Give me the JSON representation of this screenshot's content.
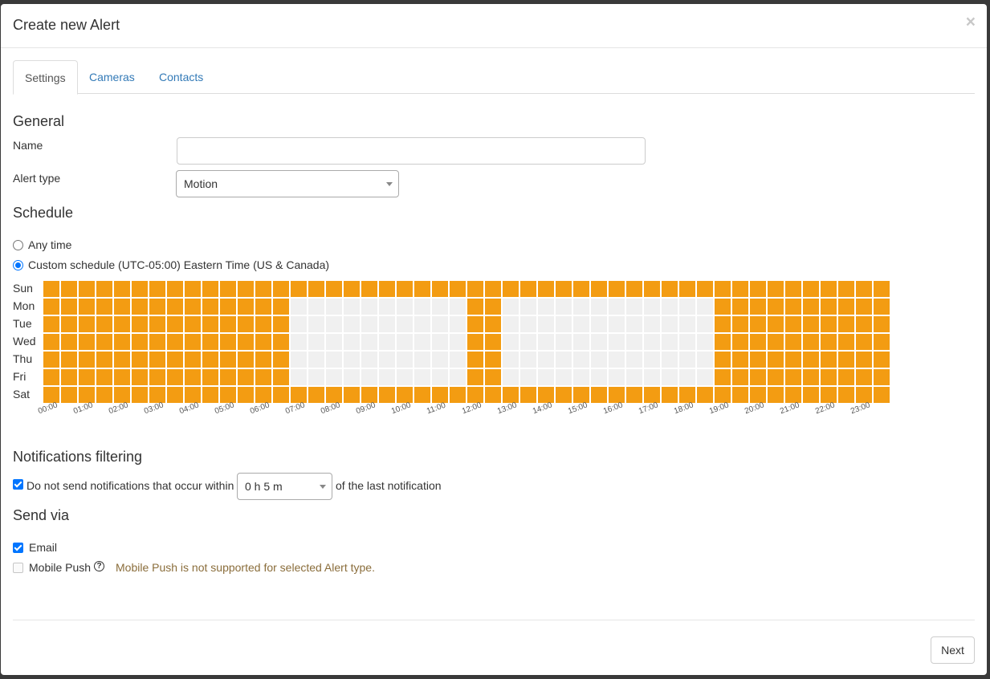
{
  "dialog": {
    "title": "Create new Alert",
    "close_label": "×"
  },
  "tabs": [
    {
      "label": "Settings",
      "active": true
    },
    {
      "label": "Cameras",
      "active": false
    },
    {
      "label": "Contacts",
      "active": false
    }
  ],
  "general": {
    "title": "General",
    "name_label": "Name",
    "name_value": "",
    "alert_type_label": "Alert type",
    "alert_type_value": "Motion"
  },
  "schedule": {
    "title": "Schedule",
    "any_time_label": "Any time",
    "custom_label": "Custom schedule (UTC-05:00) Eastern Time (US & Canada)",
    "selected_option": "custom",
    "days": [
      "Sun",
      "Mon",
      "Tue",
      "Wed",
      "Thu",
      "Fri",
      "Sat"
    ],
    "hours": [
      "00:00",
      "01:00",
      "02:00",
      "03:00",
      "04:00",
      "05:00",
      "06:00",
      "07:00",
      "08:00",
      "09:00",
      "10:00",
      "11:00",
      "12:00",
      "13:00",
      "14:00",
      "15:00",
      "16:00",
      "17:00",
      "18:00",
      "19:00",
      "20:00",
      "21:00",
      "22:00",
      "23:00"
    ],
    "half_hour_slots_per_day": 48,
    "active_color": "#f39c12",
    "inactive_color": "#f0f0f0",
    "weekday_active_ranges": [
      [
        "00:00",
        "07:00"
      ],
      [
        "12:00",
        "13:00"
      ],
      [
        "19:00",
        "24:00"
      ]
    ],
    "weekend_active_ranges": [
      [
        "00:00",
        "24:00"
      ]
    ]
  },
  "notifications": {
    "title": "Notifications filtering",
    "checkbox_checked": true,
    "prefix_label": "Do not send notifications that occur within",
    "interval_value": "0 h 5 m",
    "suffix_label": "of the last notification"
  },
  "send_via": {
    "title": "Send via",
    "email_label": "Email",
    "email_checked": true,
    "push_label": "Mobile Push",
    "push_checked": false,
    "push_help": "?",
    "push_warning": "Mobile Push is not supported for selected Alert type."
  },
  "footer": {
    "next_label": "Next"
  }
}
